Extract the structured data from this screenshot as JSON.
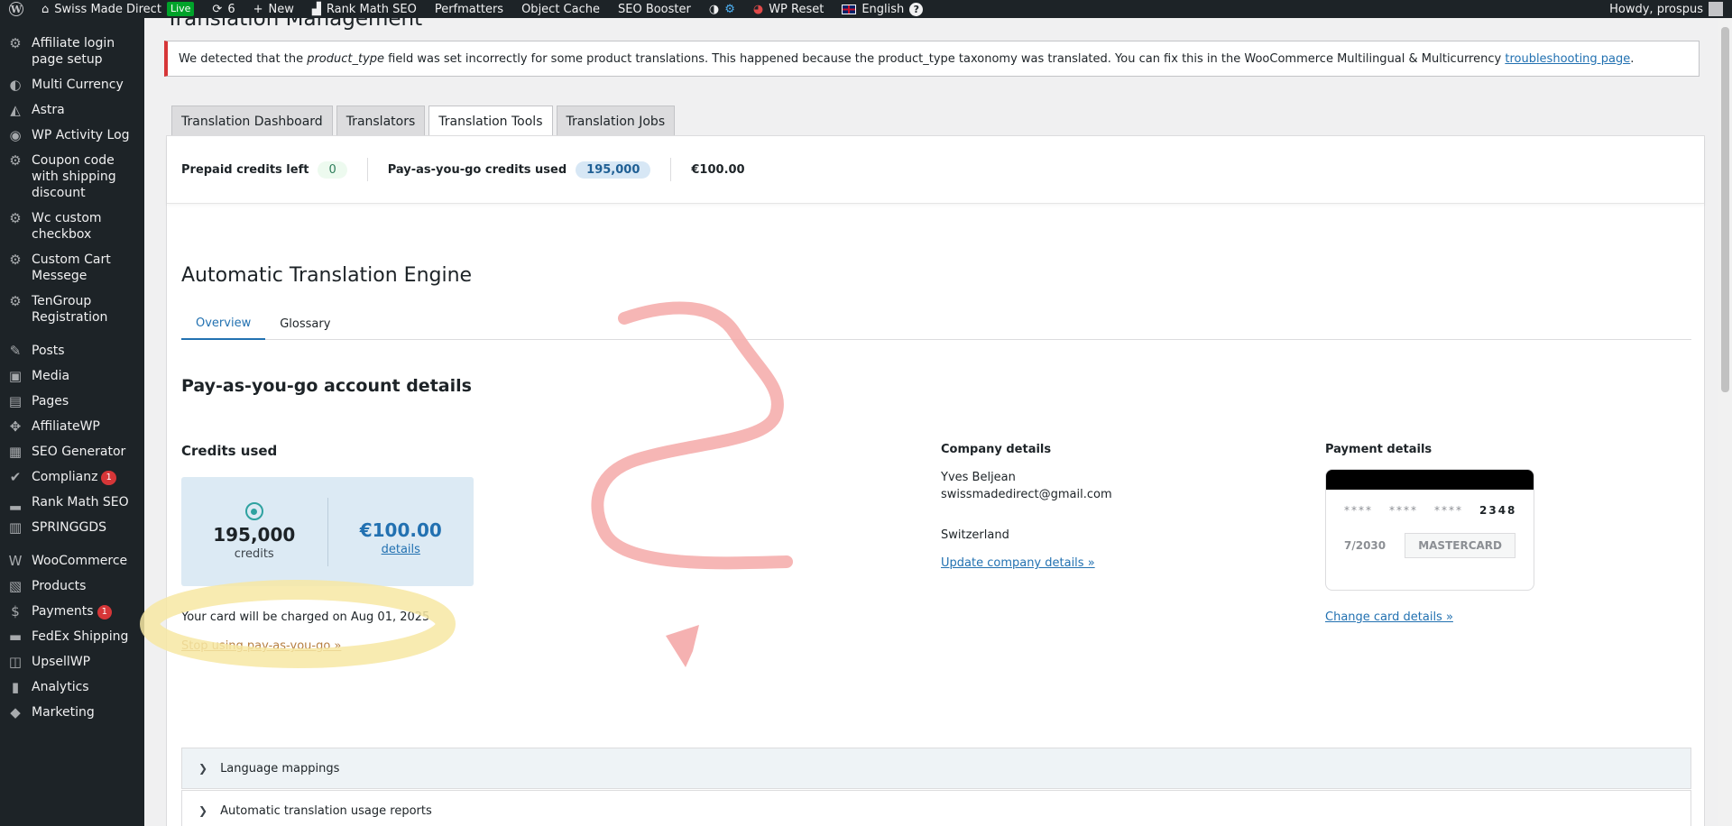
{
  "admin_bar": {
    "site_name": "Swiss Made Direct",
    "live_badge": "Live",
    "updates_count": "6",
    "new_label": "New",
    "items": [
      "Rank Math SEO",
      "Perfmatters",
      "Object Cache",
      "SEO Booster"
    ],
    "wp_reset": "WP Reset",
    "language": "English",
    "help": "?",
    "howdy": "Howdy, prospus"
  },
  "sidebar": {
    "items": [
      {
        "label": "Affiliate login page setup",
        "icon": "gear-icon",
        "glyph": "⚙"
      },
      {
        "label": "Multi Currency",
        "icon": "currency-icon",
        "glyph": "◐"
      },
      {
        "label": "Astra",
        "icon": "astra-icon",
        "glyph": "◭"
      },
      {
        "label": "WP Activity Log",
        "icon": "eye-icon",
        "glyph": "◉"
      },
      {
        "label": "Coupon code with shipping discount",
        "icon": "gear-icon",
        "glyph": "⚙"
      },
      {
        "label": "Wc custom checkbox",
        "icon": "gear-icon",
        "glyph": "⚙"
      },
      {
        "label": "Custom Cart Messege",
        "icon": "gear-icon",
        "glyph": "⚙"
      },
      {
        "label": "TenGroup Registration",
        "icon": "gear-icon",
        "glyph": "⚙"
      },
      {
        "label": "Posts",
        "icon": "pin-icon",
        "glyph": "✎"
      },
      {
        "label": "Media",
        "icon": "media-icon",
        "glyph": "▣"
      },
      {
        "label": "Pages",
        "icon": "pages-icon",
        "glyph": "▤"
      },
      {
        "label": "AffiliateWP",
        "icon": "affiliate-icon",
        "glyph": "✥"
      },
      {
        "label": "SEO Generator",
        "icon": "seo-icon",
        "glyph": "▦"
      },
      {
        "label": "Complianz",
        "icon": "check-icon",
        "glyph": "✔",
        "badge": "1"
      },
      {
        "label": "Rank Math SEO",
        "icon": "chart-icon",
        "glyph": "▂"
      },
      {
        "label": "SPRINGGDS",
        "icon": "store-icon",
        "glyph": "▥"
      },
      {
        "label": "WooCommerce",
        "icon": "woo-icon",
        "glyph": "W"
      },
      {
        "label": "Products",
        "icon": "box-icon",
        "glyph": "▧"
      },
      {
        "label": "Payments",
        "icon": "dollar-icon",
        "glyph": "$",
        "badge": "1"
      },
      {
        "label": "FedEx Shipping",
        "icon": "truck-icon",
        "glyph": "▬"
      },
      {
        "label": "UpsellWP",
        "icon": "cart-icon",
        "glyph": "◫"
      },
      {
        "label": "Analytics",
        "icon": "bar-chart-icon",
        "glyph": "▮"
      },
      {
        "label": "Marketing",
        "icon": "megaphone-icon",
        "glyph": "◆"
      }
    ]
  },
  "page": {
    "title": "Translation Management",
    "notice": {
      "text1": "We detected that the ",
      "em": "product_type",
      "text2": " field was set incorrectly for some product translations. This happened because the product_type taxonomy was translated. You can fix this in the WooCommerce Multilingual & Multicurrency ",
      "link": "troubleshooting page",
      "end": "."
    },
    "tabs": [
      "Translation Dashboard",
      "Translators",
      "Translation Tools",
      "Translation Jobs"
    ],
    "active_tab": "Translation Tools"
  },
  "credits_bar": {
    "prepaid_label": "Prepaid credits left",
    "prepaid_value": "0",
    "payg_label": "Pay-as-you-go credits used",
    "payg_value": "195,000",
    "amount": "€100.00"
  },
  "engine": {
    "title": "Automatic Translation Engine",
    "subtabs": [
      "Overview",
      "Glossary"
    ],
    "active_subtab": "Overview"
  },
  "account": {
    "heading": "Pay-as-you-go account details",
    "credits_used_heading": "Credits used",
    "credits_value": "195,000",
    "credits_unit": "credits",
    "money_value": "€100.00",
    "details_link": "details",
    "charge_text": "Your card will be charged on Aug 01, 2025",
    "stop_link": "Stop using pay-as-you-go »"
  },
  "company": {
    "heading": "Company details",
    "name": "Yves Beljean",
    "email": "swissmadedirect@gmail.com",
    "country": "Switzerland",
    "update_link": "Update company details »"
  },
  "payment": {
    "heading": "Payment details",
    "masked": [
      "****",
      "****",
      "****"
    ],
    "last4": "2348",
    "expiry": "7/2030",
    "brand": "MASTERCARD",
    "change_link": "Change card details »"
  },
  "accordions": [
    "Language mappings",
    "Automatic translation usage reports"
  ],
  "colors": {
    "sidebar_bg": "#1d2327",
    "link": "#2271b1",
    "notice_border": "#d63638",
    "highlight_yellow": "#f7e7a3",
    "scribble_red": "#f4a9a8"
  }
}
